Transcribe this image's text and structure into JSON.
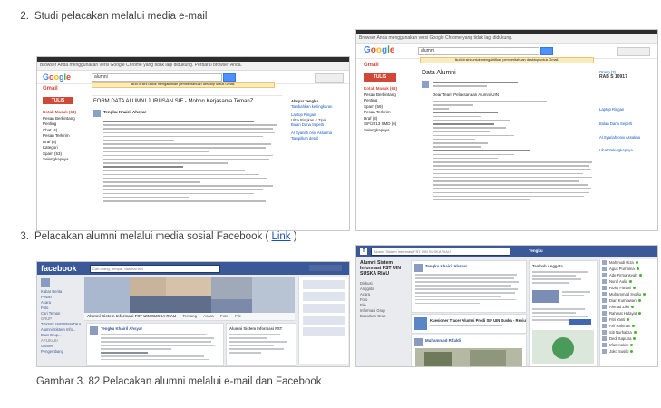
{
  "section2": {
    "number": "2.",
    "text": "Studi pelacakan melalui media e-mail"
  },
  "section3": {
    "number": "3.",
    "text": "Pelacakan alumni melalui media sosial Facebook (",
    "link": "Link",
    "tail": ")"
  },
  "caption": "Gambar 3. 82 Pelacakan alumni melalui e-mail dan Facebook",
  "gmail_left": {
    "chrome": "Browser Anda menggunakan versi Google Chrome yang tidak lagi didukung. Perbarui browser Anda.",
    "logo": [
      "G",
      "o",
      "o",
      "g",
      "l",
      "e"
    ],
    "search_value": "alumni",
    "gmail_label": "Gmail",
    "compose": "TULIS",
    "folders": [
      "Kotak Masuk (63)",
      "Pesan Berbintang",
      "Penting",
      "Chat (4)",
      "Pesan Terkirim",
      "Draf (3)",
      "Kategori",
      "Spam (53)",
      "Selengkapnya"
    ],
    "title": "FORM DATA ALUMNI JURUSAN SIF - Mohon Kerjasama TemanZ",
    "banner": "Ikuti di sini untuk mengaktifkan pemberitahuan desktop untuk Gmail.",
    "sender": "Tengku Khairil Ahsyar",
    "right": [
      "Ahsyar Tengku",
      "Tambahkan ke lingkaran",
      "Laptop Ringan",
      "Ultra Ringkas & Tipis",
      "Bulan Dana Seperti",
      "Al Syariah onix Assalma",
      "Tampilkan detail"
    ]
  },
  "gmail_right": {
    "chrome": "Browser Anda menggunakan versi Google Chrome yang tidak lagi didukung.",
    "logo": [
      "G",
      "o",
      "o",
      "g",
      "l",
      "e"
    ],
    "search_value": "alumni",
    "gmail_label": "Gmail",
    "compose": "TULIS",
    "folders": [
      "Kotak Masuk (63)",
      "Pesan Berbintang",
      "Penting",
      "Spam (59)",
      "Pesan Terkirim",
      "Draf (3)",
      "SIF/2013 SMD (6)",
      "Selengkapnya"
    ],
    "title": "Data Alumni",
    "banner": "Ikuti di sini untuk mengaktifkan pemberitahuan desktop untuk Gmail.",
    "sender": "Dear Team Pelaksanaan Alumni UIN",
    "right": [
      "Orang (3)",
      "RAB S 10917",
      "Laptop Ringan",
      "Bulan Dana Seperti",
      "Al Syariah onix Assalma",
      "Lihat Selengkapnya"
    ]
  },
  "fb_left": {
    "logo": "facebook",
    "search_placeholder": "Cari orang, tempat, dan hal lain",
    "group_name": "Alumni Sistem Informasi FST UIN SUSKA RIAU",
    "side_items": [
      "Kabar Berita",
      "Pesan",
      "Acara",
      "Foto",
      "Cari Teman",
      "GRUP",
      "TEKNIK INFORMATIKA",
      "Alumni Sistem Info...",
      "Buat Grup...",
      "APLIKASI",
      "Games",
      "Pengembang",
      "Acara"
    ],
    "tabs": [
      "Tentang",
      "Acara",
      "Foto",
      "File"
    ],
    "post_author": "Tengku Khairil Ahsyar",
    "post2_author": "Alumni Sistem Informasi FST"
  },
  "fb_right": {
    "search_placeholder": "Alumni Sistem Informasi FST UIN SUSKA RIAU",
    "user": "Tengku",
    "group_name": "Alumni Sistem Informasi FST UIN SUSKA RIAU",
    "nav": [
      "Diskusi",
      "Anggota",
      "Acara",
      "Foto",
      "File",
      "Informasi Grup",
      "Bubarkan Grup"
    ],
    "post_author": "Tengku Khairil Ahsyar",
    "post2_title": "Kuesioner Tracer Alumni Prodi SIF UIN Suska - Reviu",
    "post3_author": "Muhammad Rifaldi",
    "invite_title": "Tambah Anggota",
    "chat": [
      "Mahmudi Riza",
      "Agus Purnama",
      "Ade Firmansyah",
      "Nurul Aulia",
      "Rizky Fitriani",
      "Muhammad Syafiq",
      "Dian Kurniawan",
      "Ahmad Zikri",
      "Rahmat Hidayat",
      "Fitri Yanti",
      "Arif Rahman",
      "Siti Nurhaliza",
      "Dedi Saputra",
      "Irfan Hakim",
      "Joko Susilo"
    ]
  }
}
